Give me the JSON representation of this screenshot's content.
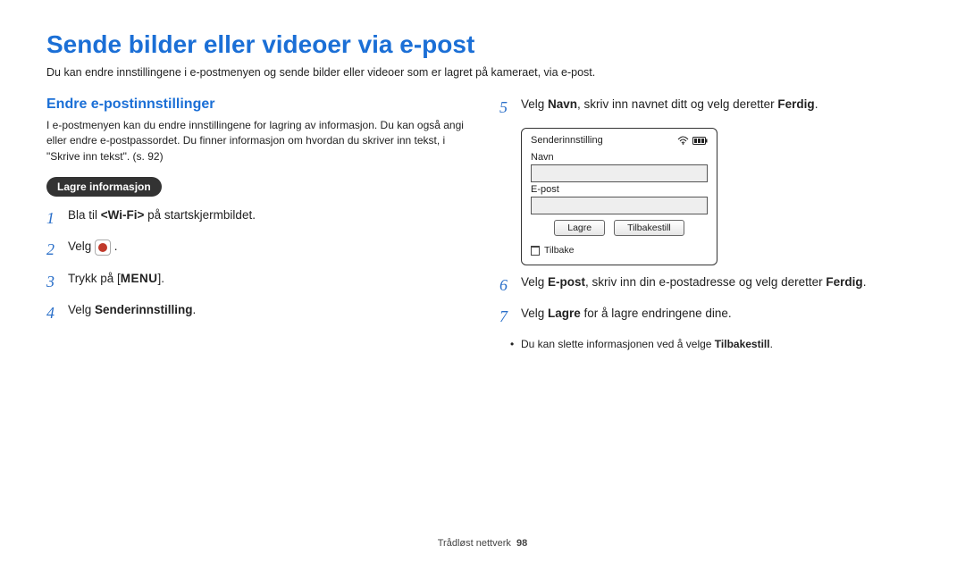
{
  "title": "Sende bilder eller videoer via e-post",
  "intro": "Du kan endre innstillingene i e-postmenyen og sende bilder eller videoer som er lagret på kameraet, via e-post.",
  "left": {
    "sub_heading": "Endre e-postinnstillinger",
    "sub_desc": "I e-postmenyen kan du endre innstillingene for lagring av informasjon. Du kan også angi eller endre e-postpassordet. Du finner informasjon om hvordan du skriver inn tekst, i \"Skrive inn tekst\". (s. 92)",
    "pill": "Lagre informasjon",
    "steps": {
      "s1_pre": "Bla til ",
      "s1_mid": "<Wi-Fi>",
      "s1_post": " på startskjermbildet.",
      "s2": "Velg ",
      "s3_pre": "Trykk på [",
      "s3_menu": "MENU",
      "s3_post": "].",
      "s4_pre": "Velg ",
      "s4_bold": "Senderinnstilling",
      "s4_post": "."
    }
  },
  "right": {
    "s5_pre": "Velg ",
    "s5_b1": "Navn",
    "s5_mid": ", skriv inn navnet ditt og velg deretter ",
    "s5_b2": "Ferdig",
    "s5_post": ".",
    "ui": {
      "header": "Senderinnstilling",
      "label_name": "Navn",
      "label_email": "E-post",
      "btn_save": "Lagre",
      "btn_reset": "Tilbakestill",
      "back": "Tilbake"
    },
    "s6_pre": "Velg ",
    "s6_b1": "E-post",
    "s6_mid": ", skriv inn din e-postadresse og velg deretter ",
    "s6_b2": "Ferdig",
    "s6_post": ".",
    "s7_pre": "Velg ",
    "s7_b1": "Lagre",
    "s7_post": " for å lagre endringene dine.",
    "bullet_pre": "Du kan slette informasjonen ved å velge ",
    "bullet_b": "Tilbakestill",
    "bullet_post": "."
  },
  "footer": {
    "section": "Trådløst nettverk",
    "page": "98"
  }
}
